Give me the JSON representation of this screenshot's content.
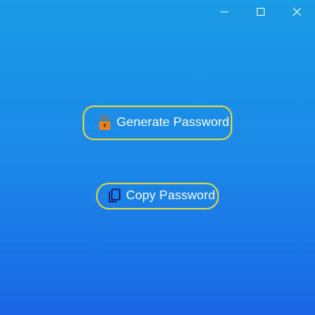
{
  "window": {
    "controls": {
      "minimize_icon": "minimize-icon",
      "maximize_icon": "maximize-icon",
      "close_icon": "close-icon"
    }
  },
  "main": {
    "generate_button": {
      "label": "Generate Password",
      "icon": "lock-icon",
      "icon_color": "#e8821e"
    },
    "copy_button": {
      "label": "Copy Password",
      "icon": "copy-icon",
      "icon_color": "#16277a"
    }
  },
  "colors": {
    "background_top": "#1a9be5",
    "background_bottom": "#1a66e6",
    "button_border": "#d6d24a",
    "text": "#ffffff"
  }
}
